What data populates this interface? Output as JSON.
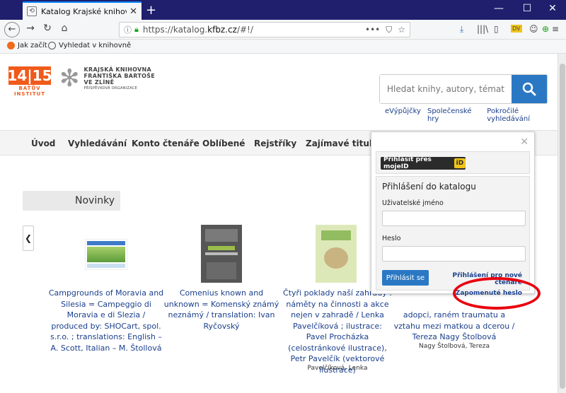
{
  "browser": {
    "tab_title": "Katalog Krajské knihovny Františka",
    "tab_close": "✕",
    "new_tab": "+",
    "url_prefix": "https://katalog.",
    "url_domain": "kfbz.cz",
    "url_suffix": "/#!/",
    "bookmarks": [
      "Jak začít",
      "Vyhledat v knihovně"
    ],
    "icon_dv": "DV"
  },
  "header": {
    "logo_number": "14|15",
    "logo_sub": "BAŤŮV INSTITUT",
    "library_lines": [
      "KRAJSKÁ KNIHOVNA",
      "FRANTIŠKA BARTOŠE",
      "VE ZLÍNĚ"
    ],
    "library_sub": "PŘÍSPĚVKOVÁ ORGANIZACE",
    "search_placeholder": "Hledat knihy, autory, témata...",
    "links": [
      "eVýpůjčky",
      "Společenské hry",
      "Pokročilé vyhledávání"
    ]
  },
  "menu": [
    "Úvod",
    "Vyhledávání",
    "Konto čtenáře",
    "Oblíbené",
    "Rejstříky",
    "Zajímavé tituly"
  ],
  "section_title": "Novinky",
  "books": [
    {
      "title": "Campgrounds of Moravia and Silesia = Campeggio di Moravia e di Slezia / produced by: SHOCart, spol. s.r.o. ; translations: English – A. Scott, Italian – M. Štollová",
      "author": ""
    },
    {
      "title": "Comenius known and unknown = Komenský známý neznámý / translation: Ivan Ryčovský",
      "author": ""
    },
    {
      "title": "Čtyři poklady naší zahrady : náměty na činnosti a akce nejen v zahradě / Lenka Pavelčíková ; ilustrace: Pavel Procházka (celostránkové ilustrace), Petr Pavelčík (vektorové ilustrace)",
      "author": "Pavelčíková, Lenka"
    },
    {
      "title": "adopci, raném traumatu a vztahu mezi matkou a dcerou / Tereza Nagy Štolbová",
      "author": "Nagy Štolbová, Tereza"
    }
  ],
  "login": {
    "mojeid_label": "Přihlásit přes mojeID",
    "mojeid_badge": "iD",
    "title": "Přihlášení do katalogu",
    "username_label": "Uživatelské jméno",
    "password_label": "Heslo",
    "submit": "Přihlásit se",
    "register": "Přihlášení pro nové čtenáře",
    "forgot": "Zapomenuté heslo",
    "close": "✕"
  }
}
